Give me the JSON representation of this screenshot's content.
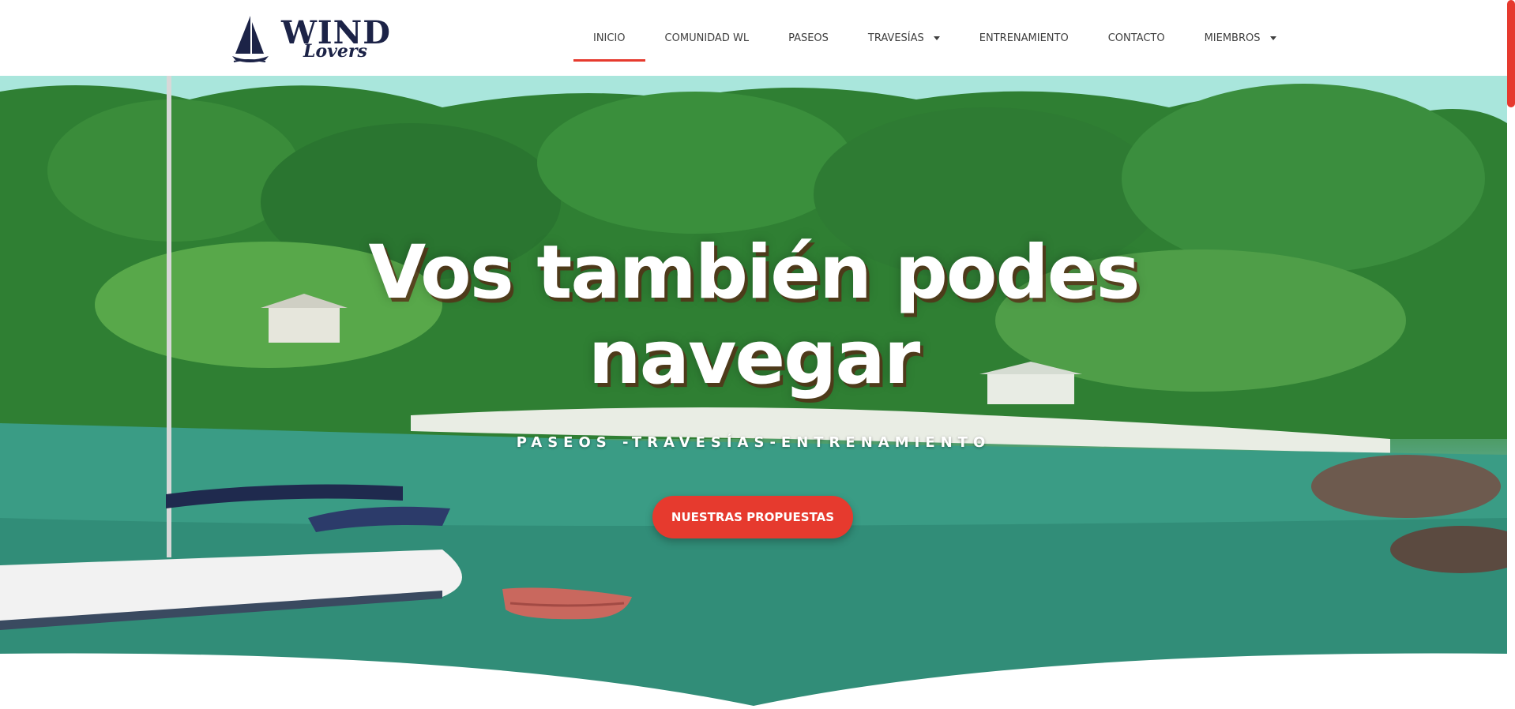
{
  "brand": {
    "line1": "WIND",
    "line2": "Lovers",
    "colors": {
      "navy": "#1c2347",
      "accent": "#e63a2e"
    }
  },
  "nav": {
    "items": [
      {
        "label": "INICIO",
        "active": true,
        "dropdown": false
      },
      {
        "label": "COMUNIDAD WL",
        "active": false,
        "dropdown": false
      },
      {
        "label": "PASEOS",
        "active": false,
        "dropdown": false
      },
      {
        "label": "TRAVESÍAS",
        "active": false,
        "dropdown": true
      },
      {
        "label": "ENTRENAMIENTO",
        "active": false,
        "dropdown": false
      },
      {
        "label": "CONTACTO",
        "active": false,
        "dropdown": false
      },
      {
        "label": "MIEMBROS",
        "active": false,
        "dropdown": true
      }
    ]
  },
  "hero": {
    "title_line1": "Vos también podes",
    "title_line2": "navegar",
    "subtitle": "PASEOS -TRAVESÍAS-ENTRENAMIENTO",
    "cta_label": "NUESTRAS PROPUESTAS",
    "background": "tropical bay with moored sailboat, dinghy and jungle shoreline"
  },
  "icons": {
    "logo": "sailboat-icon",
    "dropdown": "chevron-down-icon"
  }
}
